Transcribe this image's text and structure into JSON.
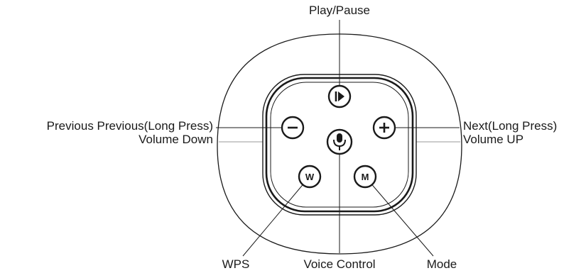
{
  "labels": {
    "play_pause": "Play/Pause",
    "left_line1": "Previous Previous(Long Press)",
    "left_line2": "Volume Down",
    "right_line1": "Next(Long Press)",
    "right_line2": "Volume UP",
    "wps": "WPS",
    "voice_control": "Voice Control",
    "mode": "Mode"
  },
  "buttons": {
    "wps_letter": "W",
    "mode_letter": "M"
  },
  "colors": {
    "stroke": "#1a1a1a",
    "faint": "#999999",
    "background": "#ffffff"
  }
}
